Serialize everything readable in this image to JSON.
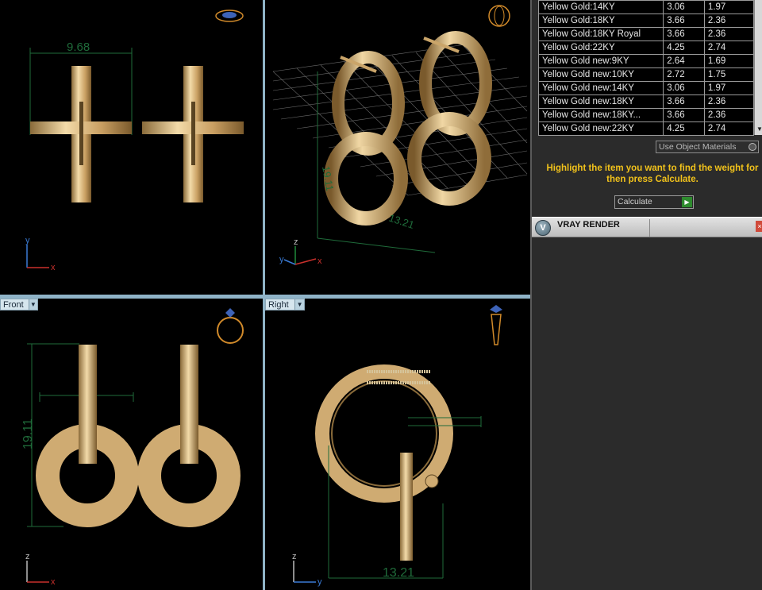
{
  "viewports": {
    "top": {
      "dimension": "9.68"
    },
    "perspective": {
      "dimension_a": "19.11",
      "dimension_b": "13.21"
    },
    "front": {
      "label": "Front",
      "dimension": "19.11"
    },
    "right": {
      "label": "Right",
      "dimension": "13.21"
    }
  },
  "axes": {
    "x": "x",
    "y": "y",
    "z": "z"
  },
  "materials": [
    {
      "name": "Yellow Gold:14KY",
      "v1": "3.06",
      "v2": "1.97"
    },
    {
      "name": "Yellow Gold:18KY",
      "v1": "3.66",
      "v2": "2.36"
    },
    {
      "name": "Yellow Gold:18KY Royal",
      "v1": "3.66",
      "v2": "2.36"
    },
    {
      "name": "Yellow Gold:22KY",
      "v1": "4.25",
      "v2": "2.74"
    },
    {
      "name": "Yellow Gold new:9KY",
      "v1": "2.64",
      "v2": "1.69"
    },
    {
      "name": "Yellow Gold new:10KY",
      "v1": "2.72",
      "v2": "1.75"
    },
    {
      "name": "Yellow Gold new:14KY",
      "v1": "3.06",
      "v2": "1.97"
    },
    {
      "name": "Yellow Gold new:18KY",
      "v1": "3.66",
      "v2": "2.36"
    },
    {
      "name": "Yellow Gold new:18KY...",
      "v1": "3.66",
      "v2": "2.36"
    },
    {
      "name": "Yellow Gold new:22KY",
      "v1": "4.25",
      "v2": "2.74"
    }
  ],
  "panel": {
    "use_object_materials": "Use Object Materials",
    "hint": "Highlight the item you want to find the weight for then press Calculate.",
    "calculate_label": "Calculate",
    "vray_title": "VRAY RENDER"
  },
  "colors": {
    "gold": "#d9b57a",
    "dimension": "#1f6b3a",
    "panel": "#2b2b2b",
    "hint": "#f1c21b"
  }
}
